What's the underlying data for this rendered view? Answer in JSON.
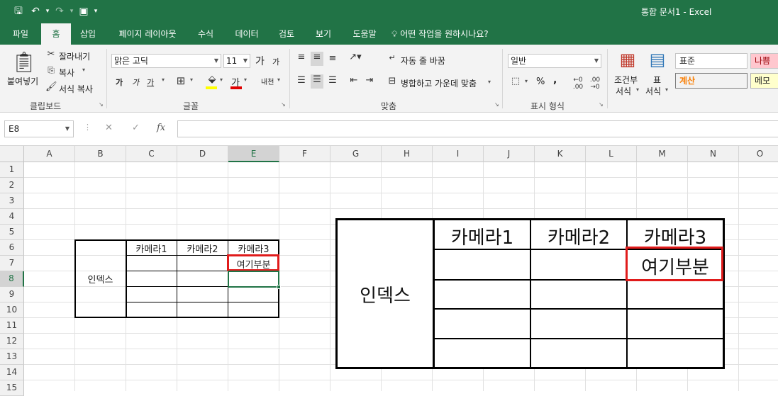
{
  "title_bar": {
    "window_title": "통합 문서1  -  Excel"
  },
  "ribbon_tabs": [
    "파일",
    "홈",
    "삽입",
    "페이지 레이아웃",
    "수식",
    "데이터",
    "검토",
    "보기",
    "도움말"
  ],
  "tell_me": "어떤 작업을 원하시나요?",
  "clipboard": {
    "paste": "붙여넣기",
    "cut": "잘라내기",
    "copy": "복사",
    "format_painter": "서식 복사",
    "group": "클립보드"
  },
  "font": {
    "name": "맑은 고딕",
    "size": "11",
    "group": "글꼴",
    "bold": "가",
    "italic": "가",
    "underline": "가",
    "color_label": "가",
    "phonetic": "내천",
    "grow": "가",
    "shrink": "가"
  },
  "alignment": {
    "wrap": "자동 줄 바꿈",
    "merge": "병합하고 가운데 맞춤",
    "group": "맞춤"
  },
  "number": {
    "format": "일반",
    "percent": "%",
    "comma": ",",
    "group": "표시 형식"
  },
  "styles": {
    "conditional": [
      "조건부",
      "서식"
    ],
    "table": [
      "표",
      "서식"
    ],
    "normal": "표준",
    "bad": "나쁨",
    "calc": "계산",
    "memo": "메모"
  },
  "formula_bar": {
    "name_box": "E8",
    "fx": "fx",
    "value": ""
  },
  "columns": [
    "A",
    "B",
    "C",
    "D",
    "E",
    "F",
    "G",
    "H",
    "I",
    "J",
    "K",
    "L",
    "M",
    "N",
    "O"
  ],
  "rows": [
    "1",
    "2",
    "3",
    "4",
    "5",
    "6",
    "7",
    "8",
    "9",
    "10",
    "11",
    "12",
    "13",
    "14",
    "15"
  ],
  "selected_cell": "E8",
  "sheet_table": {
    "row_header": "인덱스",
    "headers": [
      "카메라1",
      "카메라2",
      "카메라3"
    ],
    "highlight_text": "여기부분"
  },
  "zoom_illustration": {
    "row_header": "인덱스",
    "headers": [
      "카메라1",
      "카메라2",
      "카메라3"
    ],
    "highlight_text": "여기부분"
  },
  "colors": {
    "excel_green": "#217346",
    "highlight_red": "#e01b1b",
    "bad_style_bg": "#ffc7ce",
    "calc_style_fg": "#fa7d00",
    "calc_style_bg": "#f2f2f2",
    "memo_style_bg": "#ffffcc"
  }
}
